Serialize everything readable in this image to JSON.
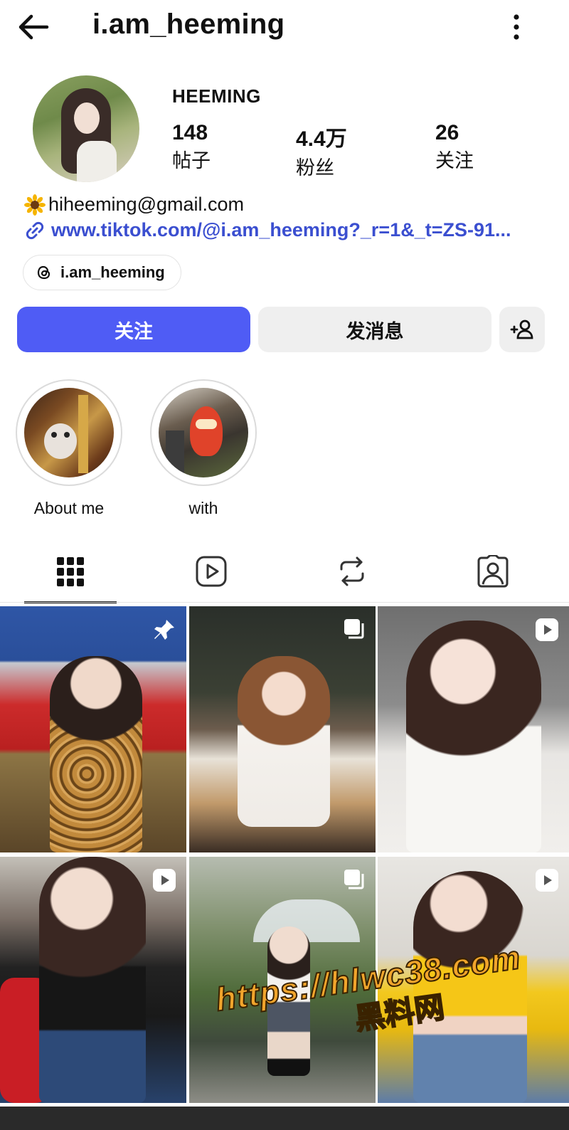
{
  "header": {
    "username": "i.am_heeming",
    "back_icon": "arrow-left-icon",
    "more_icon": "more-vertical-icon"
  },
  "profile": {
    "display_name": "HEEMING",
    "stats": [
      {
        "value": "148",
        "label": "帖子"
      },
      {
        "value": "4.4万",
        "label": "粉丝"
      },
      {
        "value": "26",
        "label": "关注"
      }
    ],
    "bio_emoji_icon": "sunflower-icon",
    "bio_text": "hiheeming@gmail.com",
    "link_icon": "link-icon",
    "link_text": "www.tiktok.com/@i.am_heeming?_r=1&_t=ZS-91...",
    "threads_handle": "i.am_heeming",
    "accent_color": "#4f5cf5",
    "link_color": "#3b4fd0"
  },
  "actions": {
    "follow_label": "关注",
    "message_label": "发消息",
    "suggest_icon": "add-person-icon"
  },
  "highlights": [
    {
      "label": "About me"
    },
    {
      "label": "with"
    }
  ],
  "tabs": [
    {
      "icon": "grid-icon",
      "active": true
    },
    {
      "icon": "reels-icon",
      "active": false
    },
    {
      "icon": "reposts-icon",
      "active": false
    },
    {
      "icon": "tagged-icon",
      "active": false
    }
  ],
  "posts": [
    {
      "badge": "pin-icon"
    },
    {
      "badge": "carousel-icon"
    },
    {
      "badge": "reel-icon"
    },
    {
      "badge": "reel-icon"
    },
    {
      "badge": "carousel-icon"
    },
    {
      "badge": "reel-icon"
    }
  ],
  "watermark": {
    "url": "https://hlwc38.com",
    "label": "黑料网"
  }
}
